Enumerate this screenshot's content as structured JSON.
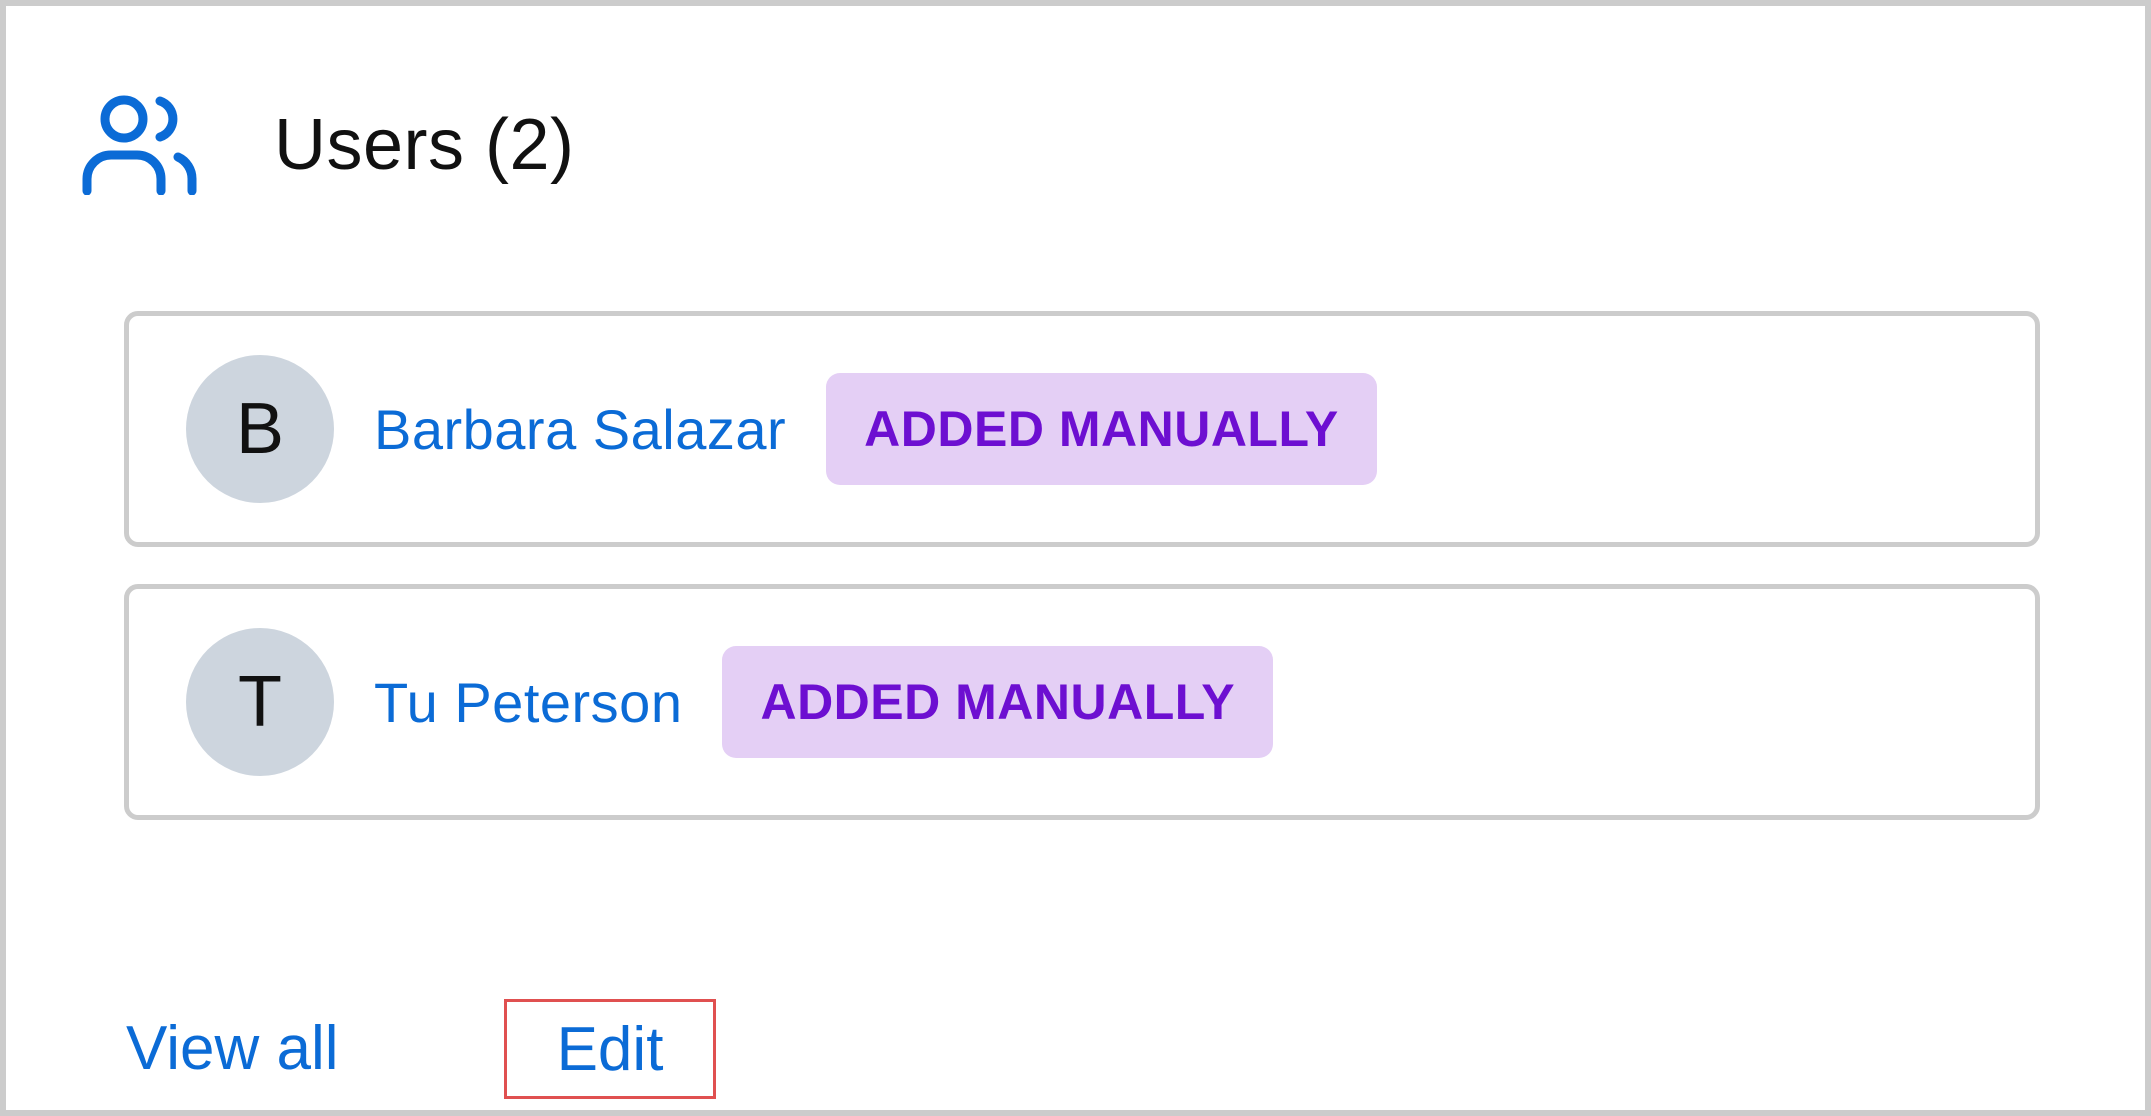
{
  "header": {
    "icon": "users-icon",
    "title": "Users (2)"
  },
  "users": [
    {
      "initial": "B",
      "name": "Barbara Salazar",
      "badge": "ADDED MANUALLY"
    },
    {
      "initial": "T",
      "name": "Tu Peterson",
      "badge": "ADDED MANUALLY"
    }
  ],
  "footer": {
    "view_all_label": "View all",
    "edit_label": "Edit"
  },
  "colors": {
    "link": "#0b6bd6",
    "badge_bg": "#e4cff5",
    "badge_text": "#6d0fd1",
    "avatar_bg": "#cdd5de",
    "border": "#cccccc",
    "highlight": "#e05050"
  }
}
